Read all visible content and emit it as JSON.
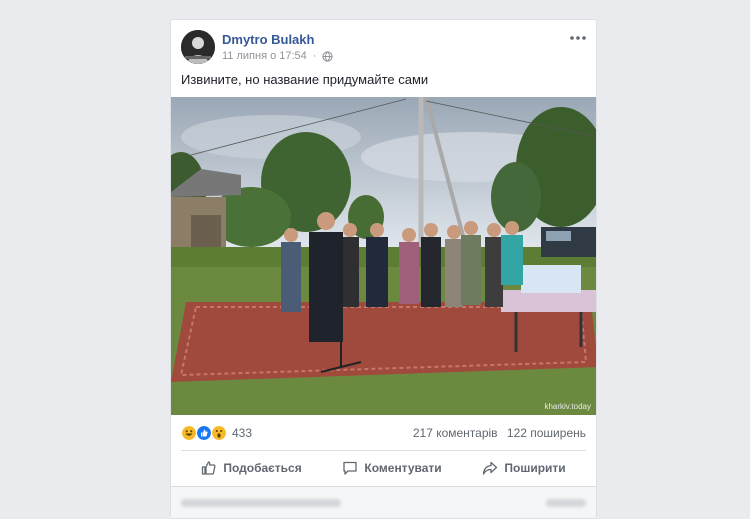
{
  "post": {
    "author": "Dmytro Bulakh",
    "timestamp": "11 липня о 17:54",
    "privacy_icon": "globe-icon",
    "more_icon": "more-options-icon",
    "text": "Извините, но название придумайте сами",
    "photo": {
      "watermark": "kharkiv.today",
      "alt": "photo"
    }
  },
  "reactions": {
    "icons": [
      "haha-icon",
      "like-icon",
      "wow-icon"
    ],
    "count": "433",
    "comments": "217 коментарів",
    "shares": "122 поширень"
  },
  "actions": {
    "like": "Подобається",
    "comment": "Коментувати",
    "share": "Поширити"
  },
  "colors": {
    "background": "#e9ebee",
    "author_link": "#365899",
    "like_blue": "#1877f2",
    "haha_yellow": "#f7b928"
  }
}
